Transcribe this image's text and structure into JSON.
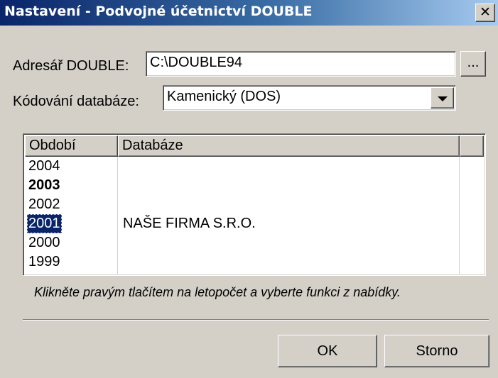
{
  "window": {
    "title": "Nastavení - Podvojné účetnictví DOUBLE",
    "close_glyph": "✕"
  },
  "form": {
    "dir_label": "Adresář DOUBLE:",
    "dir_value": "C:\\DOUBLE94",
    "browse_label": "...",
    "encoding_label": "Kódování databáze:",
    "encoding_value": "Kamenický (DOS)"
  },
  "table": {
    "columns": [
      "Období",
      "Databáze",
      ""
    ],
    "rows": [
      {
        "period": "2004",
        "database": "",
        "bold": false,
        "selected": false
      },
      {
        "period": "2003",
        "database": "",
        "bold": true,
        "selected": false
      },
      {
        "period": "2002",
        "database": "",
        "bold": false,
        "selected": false
      },
      {
        "period": "2001",
        "database": "NAŠE FIRMA S.R.O.",
        "bold": false,
        "selected": true
      },
      {
        "period": "2000",
        "database": "",
        "bold": false,
        "selected": false
      },
      {
        "period": "1999",
        "database": "",
        "bold": false,
        "selected": false
      }
    ]
  },
  "hint": "Klikněte pravým tlačítem na letopočet a vyberte funkci z nabídky.",
  "buttons": {
    "ok": "OK",
    "cancel": "Storno"
  },
  "colors": {
    "face": "#d4d0c8",
    "title_start": "#0a246a",
    "title_end": "#a6caf0",
    "selection": "#0a246a"
  }
}
